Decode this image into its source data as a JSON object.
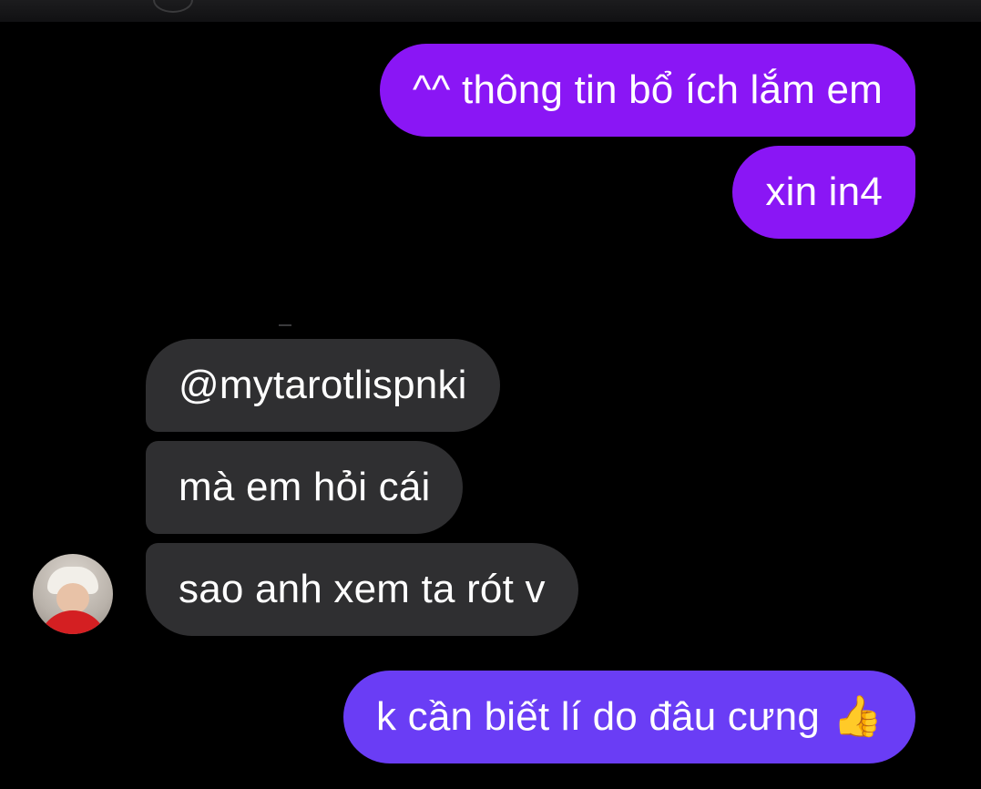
{
  "messages": {
    "outgoing_1": "^^ thông tin bổ ích lắm em",
    "outgoing_2": "xin in4",
    "incoming_1": "@mytarotlispnki",
    "incoming_2": "mà em hỏi cái",
    "incoming_3": "sao anh xem ta rót v",
    "outgoing_3": "k cần biết lí do đâu cưng",
    "outgoing_3_emoji": "👍"
  },
  "colors": {
    "background": "#000000",
    "outgoing_bubble": "#8a16f5",
    "outgoing_bubble_last": "#6a3df5",
    "incoming_bubble": "#2f2f31",
    "text": "#ffffff"
  },
  "icons": {
    "avatar": "profile-photo-avatar",
    "emoji": "thumbs-up-emoji"
  }
}
